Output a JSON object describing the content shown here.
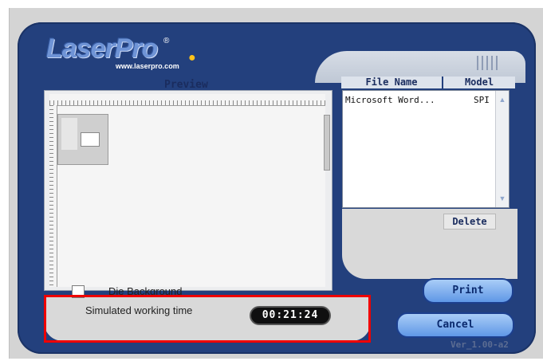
{
  "logo": {
    "brand": "LaserPro",
    "registered_mark": "®",
    "url": "www.laserpro.com"
  },
  "preview": {
    "label": "Preview"
  },
  "file_list": {
    "headers": {
      "name": "File Name",
      "model": "Model"
    },
    "rows": [
      {
        "name": "Microsoft Word...",
        "model": "SPI"
      }
    ]
  },
  "buttons": {
    "delete": "Delete",
    "print": "Print",
    "cancel": "Cancel"
  },
  "options": {
    "die_background_label": "Die Background"
  },
  "working_time": {
    "label": "Simulated working time",
    "value": "00:21:24"
  },
  "version": "Ver_1.00-a2",
  "colors": {
    "panel": "#23407d",
    "button": "#5f97e6",
    "highlight": "#ef0000"
  }
}
